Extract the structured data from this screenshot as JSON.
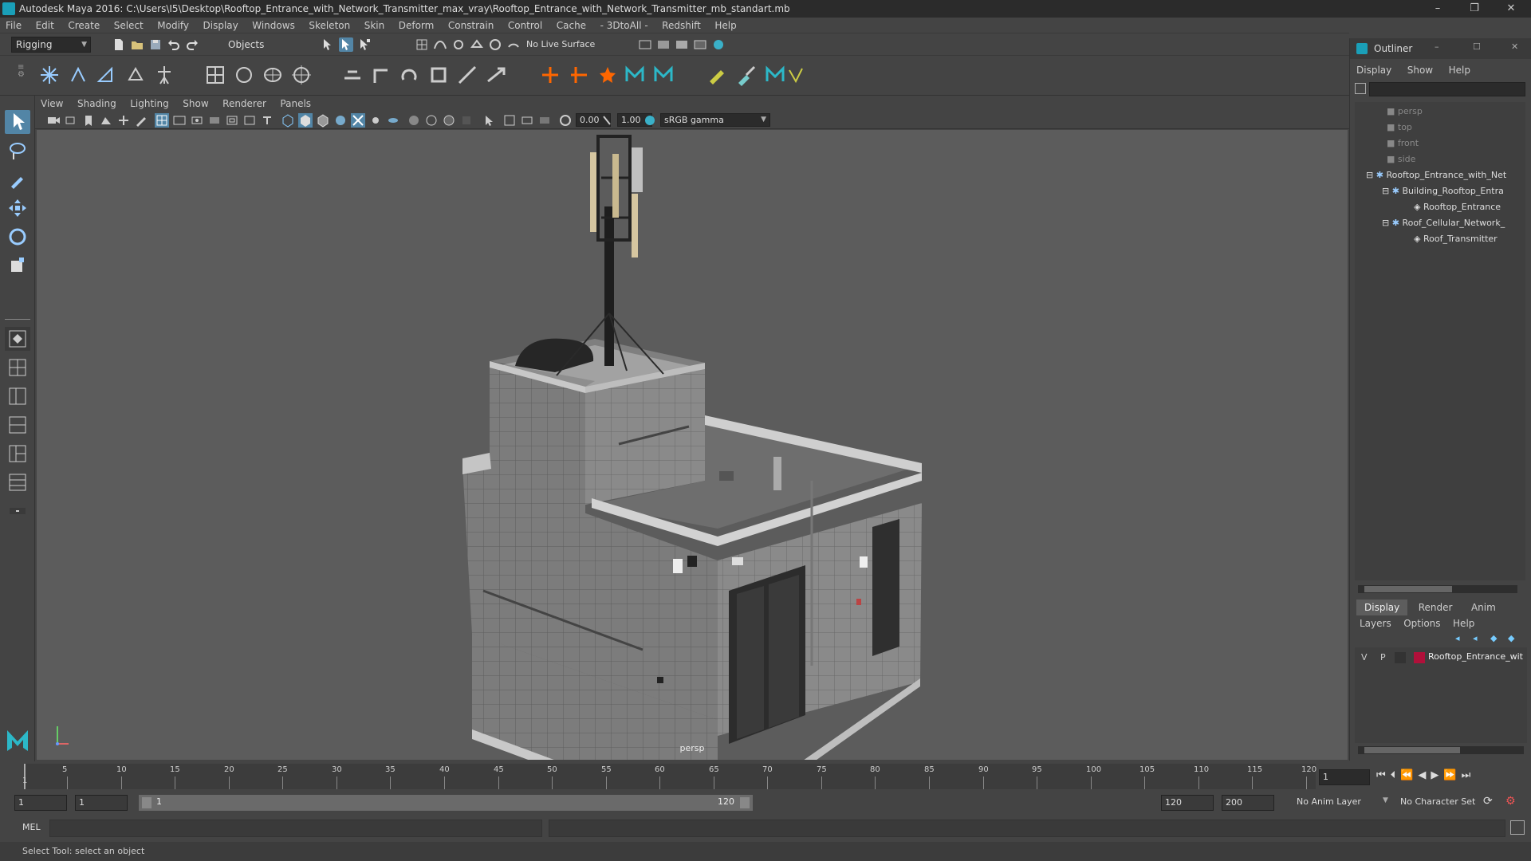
{
  "window": {
    "title": "Autodesk Maya 2016: C:\\Users\\I5\\Desktop\\Rooftop_Entrance_with_Network_Transmitter_max_vray\\Rooftop_Entrance_with_Network_Transmitter_mb_standart.mb",
    "minimize": "–",
    "restore": "❐",
    "close": "✕"
  },
  "menubar": [
    "File",
    "Edit",
    "Create",
    "Select",
    "Modify",
    "Display",
    "Windows",
    "Skeleton",
    "Skin",
    "Deform",
    "Constrain",
    "Control",
    "Cache",
    "- 3DtoAll -",
    "Redshift",
    "Help"
  ],
  "statusline": {
    "mode": "Rigging",
    "selection_mode": "Objects",
    "live_surface": "No Live Surface"
  },
  "panel": {
    "menu": [
      "View",
      "Shading",
      "Lighting",
      "Show",
      "Renderer",
      "Panels"
    ],
    "exposure": "0.00",
    "gamma": "1.00",
    "colorspace": "sRGB gamma",
    "camera_label": "persp"
  },
  "outliner": {
    "title": "Outliner",
    "menu": [
      "Display",
      "Show",
      "Help"
    ],
    "minimize": "–",
    "maximize": "☐",
    "close": "✕",
    "items": [
      {
        "label": "persp",
        "dim": true
      },
      {
        "label": "top",
        "dim": true
      },
      {
        "label": "front",
        "dim": true
      },
      {
        "label": "side",
        "dim": true
      },
      {
        "label": "Rooftop_Entrance_with_Net",
        "dim": false
      },
      {
        "label": "Building_Rooftop_Entra",
        "dim": false
      },
      {
        "label": "Rooftop_Entrance",
        "dim": false
      },
      {
        "label": "Roof_Cellular_Network_",
        "dim": false
      },
      {
        "label": "Roof_Transmitter",
        "dim": false
      }
    ]
  },
  "layers": {
    "tabs": [
      "Display",
      "Render",
      "Anim"
    ],
    "menu": [
      "Layers",
      "Options",
      "Help"
    ],
    "layer": {
      "v": "V",
      "p": "P",
      "name": "Rooftop_Entrance_wit",
      "color": "#b0103a"
    }
  },
  "timeline": {
    "ticks": [
      "5",
      "10",
      "15",
      "20",
      "25",
      "30",
      "35",
      "40",
      "45",
      "50",
      "55",
      "60",
      "65",
      "70",
      "75",
      "80",
      "85",
      "90",
      "95",
      "100",
      "105",
      "110",
      "115",
      "120"
    ],
    "start_label": "1",
    "current_frame": "1"
  },
  "range": {
    "start": "1",
    "playback_start": "1",
    "slider_start": "1",
    "slider_end": "120",
    "playback_end": "120",
    "end": "200",
    "anim_layer": "No Anim Layer",
    "character_set": "No Character Set"
  },
  "cmdline": {
    "lang": "MEL"
  },
  "helpline": {
    "text": "Select Tool: select an object"
  }
}
